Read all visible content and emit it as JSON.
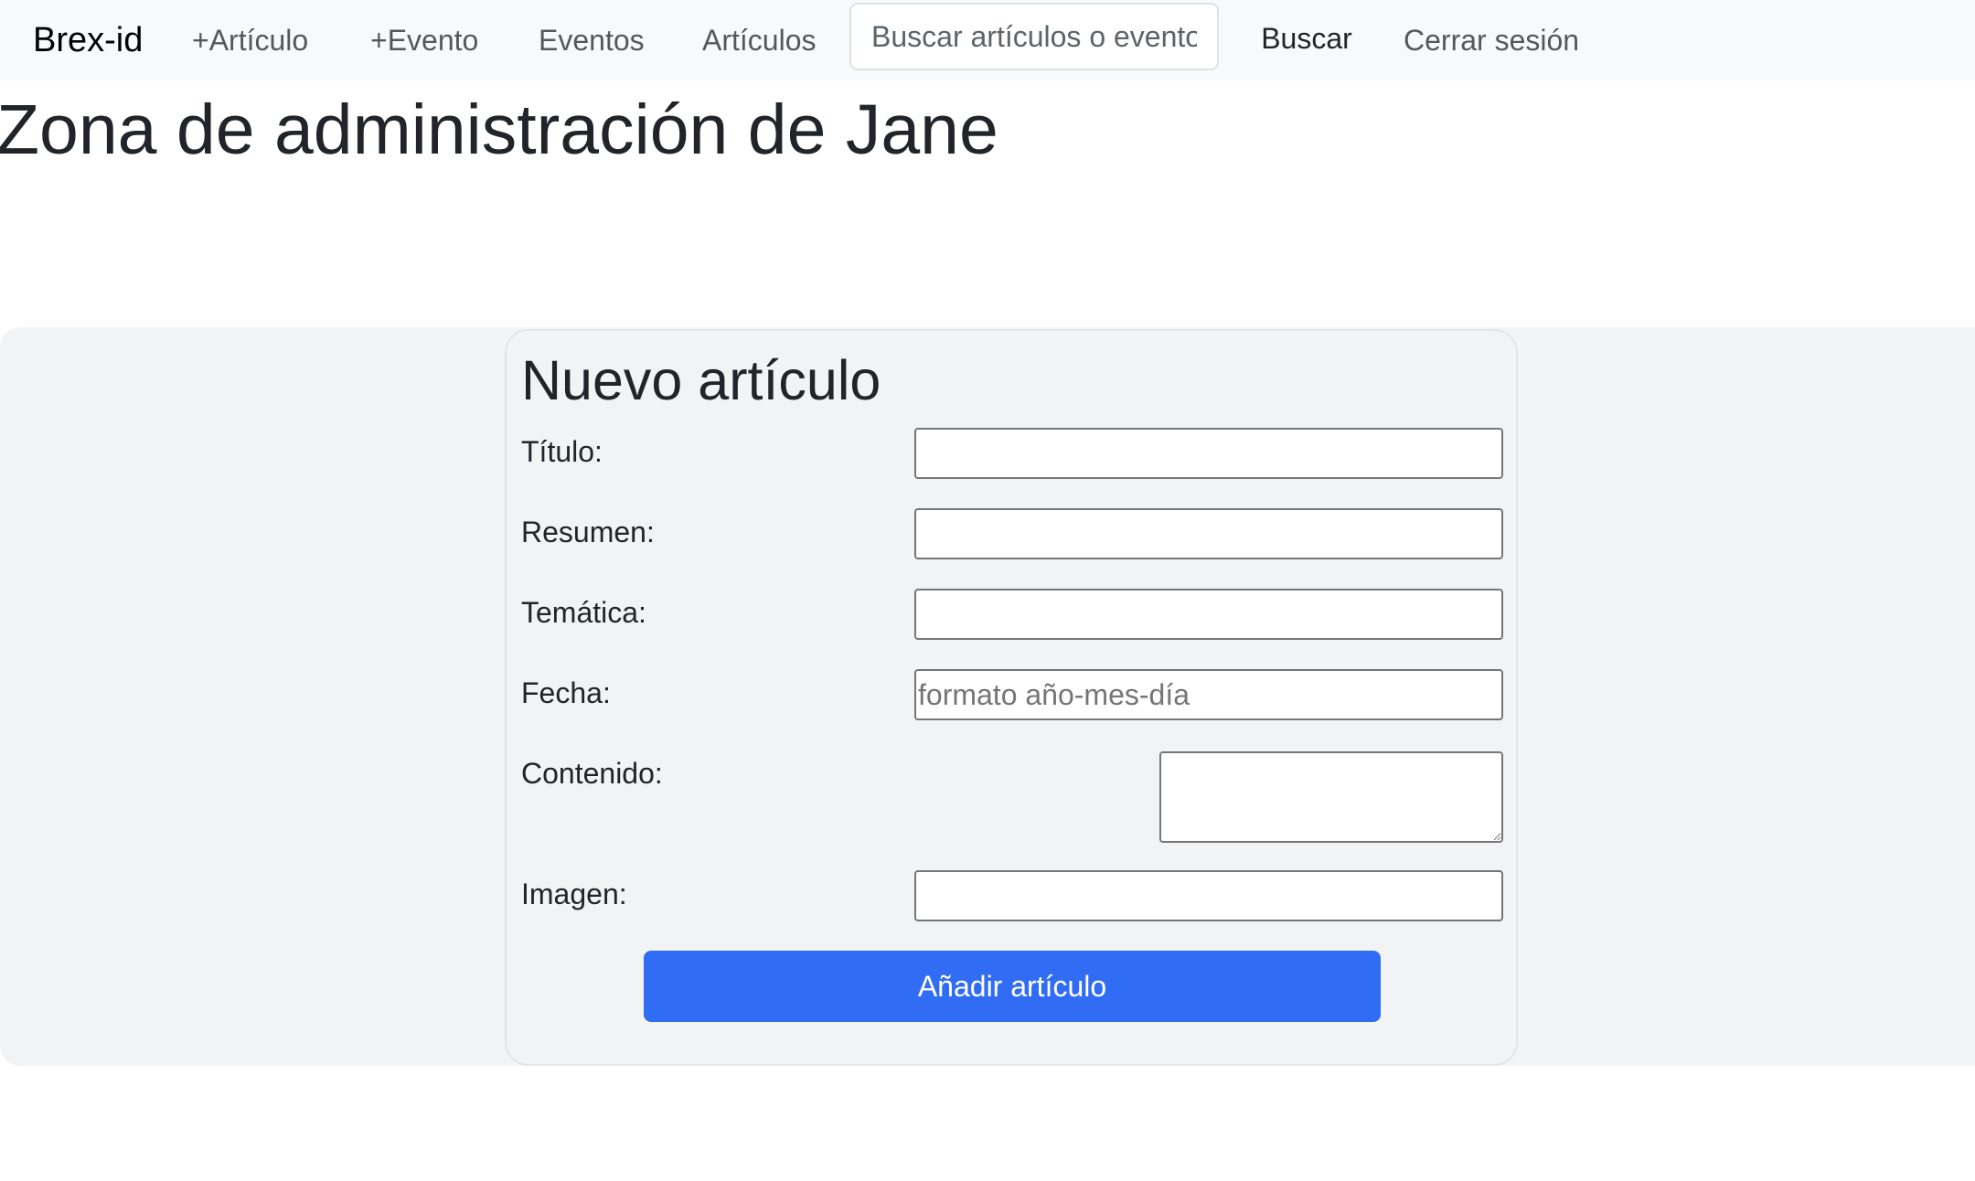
{
  "navbar": {
    "brand": "Brex-id",
    "links": [
      "+Artículo",
      "+Evento",
      "Eventos",
      "Artículos"
    ],
    "search": {
      "placeholder": "Buscar artículos o eventos",
      "value": "",
      "button_label": "Buscar"
    },
    "logout_label": "Cerrar sesión"
  },
  "page_title": "Zona de administración de Jane",
  "form": {
    "heading": "Nuevo artículo",
    "fields": [
      {
        "label": "Título:",
        "value": "",
        "placeholder": ""
      },
      {
        "label": "Resumen:",
        "value": "",
        "placeholder": ""
      },
      {
        "label": "Temática:",
        "value": "",
        "placeholder": ""
      },
      {
        "label": "Fecha:",
        "value": "",
        "placeholder": "formato año-mes-día"
      },
      {
        "label": "Contenido:",
        "value": "",
        "placeholder": ""
      },
      {
        "label": "Imagen:",
        "value": "",
        "placeholder": ""
      }
    ],
    "submit_label": "Añadir artículo"
  },
  "colors": {
    "navbar_bg": "#f8f9fa",
    "panel_bg": "#f2f3f5",
    "primary_button": "#316cf4",
    "text": "#212529"
  }
}
